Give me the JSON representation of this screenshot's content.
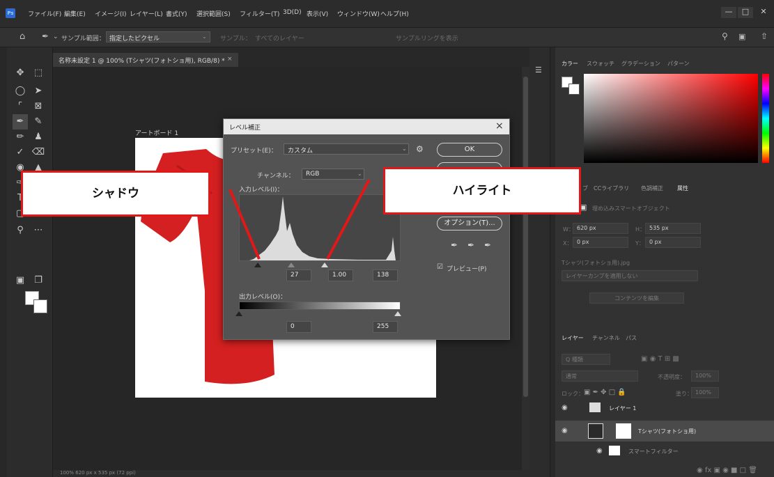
{
  "menubar": {
    "logo": "Ps",
    "items": [
      "ファイル(F)",
      "編集(E)",
      "イメージ(I)",
      "レイヤー(L)",
      "書式(Y)",
      "選択範囲(S)",
      "フィルター(T)",
      "3D(D)",
      "表示(V)",
      "ウィンドウ(W)",
      "ヘルプ(H)"
    ]
  },
  "optionsbar": {
    "sample_size_label": "サンプル範囲：",
    "sample_size_value": "指定したピクセル",
    "sample_label": "サンプル：",
    "sample_value": "すべてのレイヤー",
    "show_ring": "サンプルリングを表示"
  },
  "document": {
    "tab_title": "名称未設定 1 @ 100% (Tシャツ(フォトショ用), RGB/8) *",
    "artboard_label": "アートボード 1",
    "status": "100%      620 px x 535 px (72 ppi)"
  },
  "dialog": {
    "title": "レベル補正",
    "preset_label": "プリセット(E)：",
    "preset_value": "カスタム",
    "ok_label": "OK",
    "channel_label": "チャンネル：",
    "channel_value": "RGB",
    "input_label": "入力レベル(I)：",
    "options_label": "オプション(T)...",
    "preview_label": "プレビュー(P)",
    "input_shadow": "27",
    "input_midtone": "1.00",
    "input_highlight": "138",
    "output_label": "出力レベル(O)：",
    "output_shadow": "0",
    "output_highlight": "255"
  },
  "panels": {
    "color_tabs": [
      "カラー",
      "スウォッチ",
      "グラデーション",
      "パターン"
    ],
    "prop_tabs": [
      "ブ",
      "CCライブラリ",
      "色調補正",
      "属性"
    ],
    "prop_title": "埋め込みスマートオブジェクト",
    "w_label": "W：",
    "w_value": "620 px",
    "h_label": "H：",
    "h_value": "535 px",
    "x_label": "X：",
    "x_value": "0 px",
    "y_label": "Y：",
    "y_value": "0 px",
    "filename": "Tシャツ(フォトショ用).jpg",
    "layer_comp": "レイヤーカンプを適用しない",
    "edit_contents": "コンテンツを編集",
    "layer_tabs": [
      "レイヤー",
      "チャンネル",
      "パス"
    ],
    "search": "Q 種類",
    "blend_mode": "通常",
    "opacity_label": "不透明度：",
    "opacity_value": "100%",
    "lock_label": "ロック：",
    "fill_label": "塗り：",
    "fill_value": "100%",
    "layers": [
      "レイヤー 1",
      "Tシャツ(フォトショ用)",
      "スマートフィルター"
    ]
  },
  "callouts": {
    "shadow": "シャドウ",
    "highlight": "ハイライト"
  },
  "colors": {
    "accent_red": "#e21818",
    "shirt_red": "#d42020"
  }
}
